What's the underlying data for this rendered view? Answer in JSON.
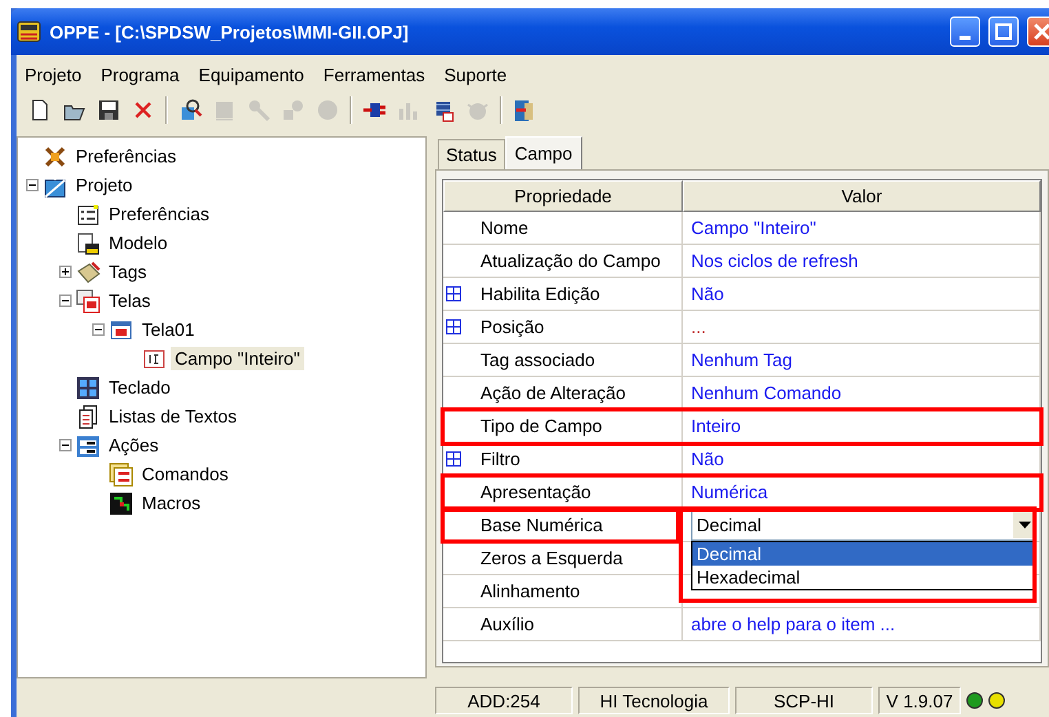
{
  "window": {
    "title": "OPPE - [C:\\SPDSW_Projetos\\MMI-GII.OPJ]"
  },
  "menu": [
    {
      "label": "Projeto"
    },
    {
      "label": "Programa"
    },
    {
      "label": "Equipamento"
    },
    {
      "label": "Ferramentas"
    },
    {
      "label": "Suporte"
    }
  ],
  "toolbar": [
    {
      "kind": "new",
      "disabled": false
    },
    {
      "kind": "open",
      "disabled": false
    },
    {
      "kind": "save",
      "disabled": false
    },
    {
      "kind": "delete",
      "disabled": false
    },
    {
      "kind": "separator"
    },
    {
      "kind": "find",
      "disabled": false
    },
    {
      "kind": "block",
      "disabled": true
    },
    {
      "kind": "tool",
      "disabled": true
    },
    {
      "kind": "shapes",
      "disabled": true
    },
    {
      "kind": "circle",
      "disabled": true
    },
    {
      "kind": "separator"
    },
    {
      "kind": "plug",
      "disabled": false
    },
    {
      "kind": "chart",
      "disabled": true
    },
    {
      "kind": "chip",
      "disabled": false
    },
    {
      "kind": "bug",
      "disabled": true
    },
    {
      "kind": "separator"
    },
    {
      "kind": "exit",
      "disabled": false
    }
  ],
  "tree": [
    {
      "label": "Preferências",
      "kind": "tools",
      "selected": false
    },
    {
      "label": "Projeto",
      "kind": "blueprint",
      "selected": false,
      "expanded": true,
      "children": [
        {
          "label": "Preferências",
          "kind": "checklist",
          "selected": false
        },
        {
          "label": "Modelo",
          "kind": "document",
          "selected": false
        },
        {
          "label": "Tags",
          "kind": "tags",
          "selected": false,
          "expanded": false
        },
        {
          "label": "Telas",
          "kind": "screens",
          "selected": false,
          "expanded": true,
          "children": [
            {
              "label": "Tela01",
              "kind": "screen",
              "selected": false,
              "expanded": true,
              "children": [
                {
                  "label": "Campo \"Inteiro\"",
                  "kind": "field",
                  "selected": true
                }
              ]
            }
          ]
        },
        {
          "label": "Teclado",
          "kind": "keypad",
          "selected": false
        },
        {
          "label": "Listas de Textos",
          "kind": "lists",
          "selected": false
        },
        {
          "label": "Ações",
          "kind": "actions",
          "selected": false,
          "expanded": true,
          "children": [
            {
              "label": "Comandos",
              "kind": "commands",
              "selected": false
            },
            {
              "label": "Macros",
              "kind": "macros",
              "selected": false
            }
          ]
        }
      ]
    }
  ],
  "tabs": [
    {
      "label": "Status",
      "selected": false
    },
    {
      "label": "Campo",
      "selected": true
    }
  ],
  "grid": {
    "columns": [
      "Propriedade",
      "Valor"
    ],
    "rows": [
      {
        "name": "Nome",
        "value": "Campo \"Inteiro\"",
        "kind": "text",
        "expandable": false
      },
      {
        "name": "Atualização do Campo",
        "value": "Nos ciclos de refresh",
        "kind": "text",
        "expandable": false
      },
      {
        "name": "Habilita Edição",
        "value": "Não",
        "kind": "text",
        "expandable": true
      },
      {
        "name": "Posição",
        "value": "...",
        "kind": "dots",
        "expandable": true
      },
      {
        "name": "Tag associado",
        "value": "Nenhum Tag",
        "kind": "text",
        "expandable": false
      },
      {
        "name": "Ação de Alteração",
        "value": "Nenhum Comando",
        "kind": "text",
        "expandable": false
      },
      {
        "name": "Tipo de Campo",
        "value": "Inteiro",
        "kind": "text",
        "expandable": false,
        "highlighted": true
      },
      {
        "name": "Filtro",
        "value": "Não",
        "kind": "text",
        "expandable": true
      },
      {
        "name": "Apresentação",
        "value": "Numérica",
        "kind": "text",
        "expandable": false,
        "highlighted": true
      },
      {
        "name": "Base Numérica",
        "value": "Decimal",
        "kind": "combo",
        "expandable": false,
        "highlighted": true,
        "open": true,
        "options": [
          {
            "label": "Decimal",
            "selected": true
          },
          {
            "label": "Hexadecimal",
            "selected": false
          }
        ]
      },
      {
        "name": "Zeros a Esquerda",
        "kind": "hidden",
        "expandable": false
      },
      {
        "name": "Alinhamento",
        "kind": "hidden",
        "expandable": false
      },
      {
        "name": "Auxílio",
        "value": "abre o help para o item ...",
        "kind": "text",
        "expandable": false
      }
    ]
  },
  "status_bar": {
    "panels": [
      "ADD:254",
      "HI Tecnologia",
      "SCP-HI",
      "V 1.9.07"
    ],
    "leds": [
      {
        "color": "#1f9a1f"
      },
      {
        "color": "#e8e000"
      }
    ]
  }
}
